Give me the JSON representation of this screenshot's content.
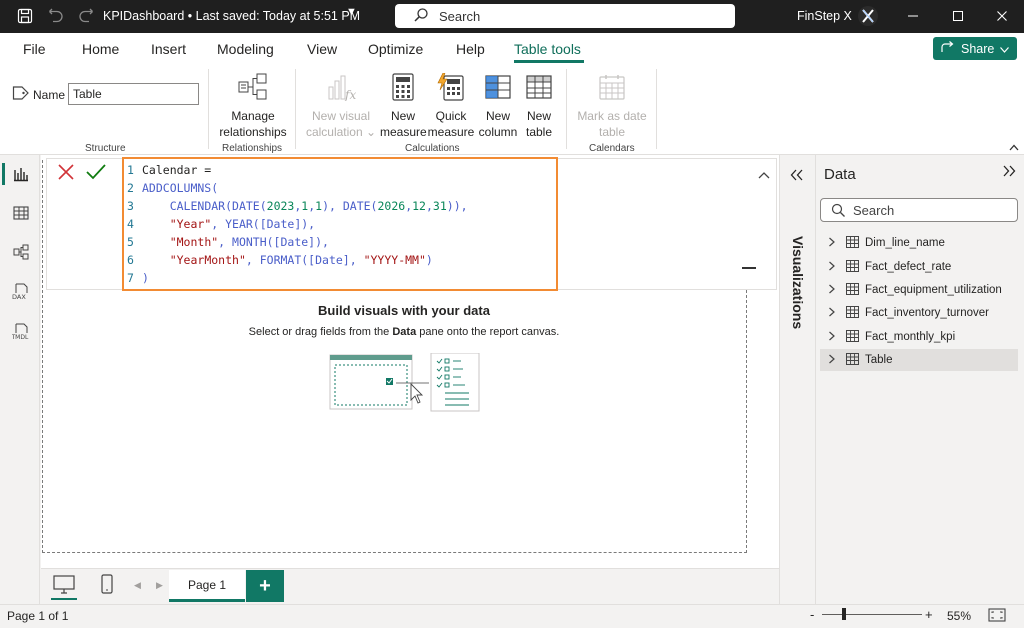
{
  "titlebar": {
    "file_title": "KPIDashboard • Last saved: Today at 5:51 PM",
    "search_label": "Search",
    "user_name": "FinStep X"
  },
  "ribbon": {
    "tabs": [
      "File",
      "Home",
      "Insert",
      "Modeling",
      "View",
      "Optimize",
      "Help",
      "Table tools"
    ],
    "active_tab": "Table tools",
    "share_label": "Share",
    "name_label": "Name",
    "name_value": "Table",
    "groups": {
      "structure": "Structure",
      "relationships": "Relationships",
      "calculations": "Calculations",
      "calendars": "Calendars"
    },
    "buttons": {
      "manage_rel_1": "Manage",
      "manage_rel_2": "relationships",
      "new_visual_calc_1": "New visual",
      "new_visual_calc_2": "calculation ⌄",
      "new_measure_1": "New",
      "new_measure_2": "measure",
      "quick_measure_1": "Quick",
      "quick_measure_2": "measure",
      "new_column_1": "New",
      "new_column_2": "column",
      "new_table_1": "New",
      "new_table_2": "table",
      "mark_date_1": "Mark as date",
      "mark_date_2": "table"
    }
  },
  "formula": {
    "lines": [
      {
        "num": "1",
        "parts": [
          {
            "t": "txt",
            "v": "Calendar ="
          }
        ]
      },
      {
        "num": "2",
        "parts": [
          {
            "t": "fn",
            "v": "ADDCOLUMNS("
          }
        ]
      },
      {
        "num": "3",
        "parts": [
          {
            "t": "txt",
            "v": "    "
          },
          {
            "t": "fn",
            "v": "CALENDAR(DATE("
          },
          {
            "t": "num",
            "v": "2023"
          },
          {
            "t": "fn",
            "v": ","
          },
          {
            "t": "num",
            "v": "1"
          },
          {
            "t": "fn",
            "v": ","
          },
          {
            "t": "num",
            "v": "1"
          },
          {
            "t": "fn",
            "v": "), DATE("
          },
          {
            "t": "num",
            "v": "2026"
          },
          {
            "t": "fn",
            "v": ","
          },
          {
            "t": "num",
            "v": "12"
          },
          {
            "t": "fn",
            "v": ","
          },
          {
            "t": "num",
            "v": "31"
          },
          {
            "t": "fn",
            "v": ")),"
          }
        ]
      },
      {
        "num": "4",
        "parts": [
          {
            "t": "txt",
            "v": "    "
          },
          {
            "t": "str",
            "v": "\"Year\""
          },
          {
            "t": "fn",
            "v": ", YEAR([Date]),"
          }
        ]
      },
      {
        "num": "5",
        "parts": [
          {
            "t": "txt",
            "v": "    "
          },
          {
            "t": "str",
            "v": "\"Month\""
          },
          {
            "t": "fn",
            "v": ", MONTH([Date]),"
          }
        ]
      },
      {
        "num": "6",
        "parts": [
          {
            "t": "txt",
            "v": "    "
          },
          {
            "t": "str",
            "v": "\"YearMonth\""
          },
          {
            "t": "fn",
            "v": ", FORMAT([Date], "
          },
          {
            "t": "str",
            "v": "\"YYYY-MM\""
          },
          {
            "t": "fn",
            "v": ")"
          }
        ]
      },
      {
        "num": "7",
        "parts": [
          {
            "t": "fn",
            "v": ")"
          }
        ]
      }
    ]
  },
  "canvas": {
    "empty_title": "Build visuals with your data",
    "empty_sub_prefix": "Select or drag fields from the ",
    "empty_sub_bold": "Data",
    "empty_sub_suffix": " pane onto the report canvas."
  },
  "pages": {
    "tabs": [
      "Page 1"
    ],
    "add_label": "+"
  },
  "status": {
    "page_count": "Page 1 of 1",
    "zoom_minus": "-",
    "zoom_plus": "+",
    "zoom_level": "55%",
    "zoom_fraction": 0.22
  },
  "visualizations": {
    "label": "Visualizations"
  },
  "data_pane": {
    "title": "Data",
    "search_placeholder": "Search",
    "tables": [
      "Dim_line_name",
      "Fact_defect_rate",
      "Fact_equipment_utilization",
      "Fact_inventory_turnover",
      "Fact_monthly_kpi",
      "Table"
    ],
    "selected": "Table"
  },
  "colors": {
    "accent": "#117865",
    "highlight": "#f28b33",
    "titlebar": "#1f1f1f"
  }
}
